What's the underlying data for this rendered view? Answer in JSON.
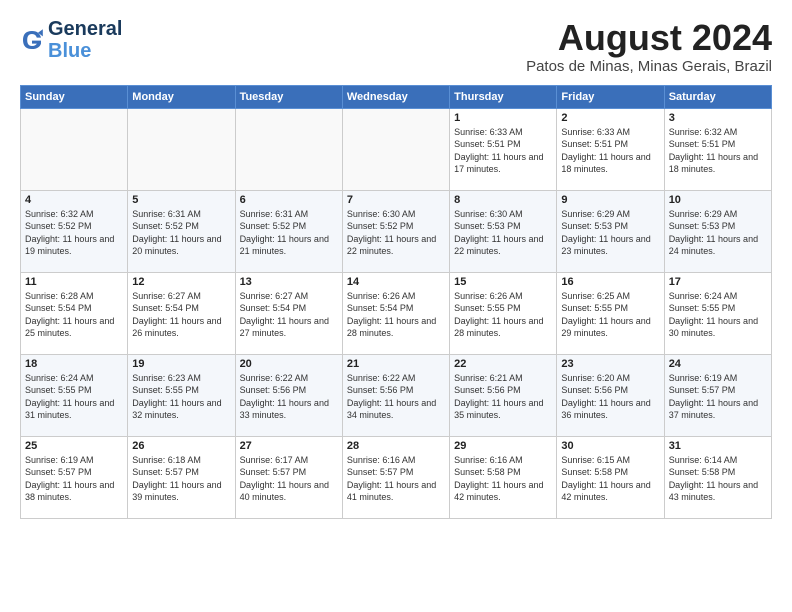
{
  "logo": {
    "line1": "General",
    "line2": "Blue"
  },
  "title": "August 2024",
  "subtitle": "Patos de Minas, Minas Gerais, Brazil",
  "weekdays": [
    "Sunday",
    "Monday",
    "Tuesday",
    "Wednesday",
    "Thursday",
    "Friday",
    "Saturday"
  ],
  "weeks": [
    [
      {
        "day": "",
        "info": ""
      },
      {
        "day": "",
        "info": ""
      },
      {
        "day": "",
        "info": ""
      },
      {
        "day": "",
        "info": ""
      },
      {
        "day": "1",
        "info": "Sunrise: 6:33 AM\nSunset: 5:51 PM\nDaylight: 11 hours and 17 minutes."
      },
      {
        "day": "2",
        "info": "Sunrise: 6:33 AM\nSunset: 5:51 PM\nDaylight: 11 hours and 18 minutes."
      },
      {
        "day": "3",
        "info": "Sunrise: 6:32 AM\nSunset: 5:51 PM\nDaylight: 11 hours and 18 minutes."
      }
    ],
    [
      {
        "day": "4",
        "info": "Sunrise: 6:32 AM\nSunset: 5:52 PM\nDaylight: 11 hours and 19 minutes."
      },
      {
        "day": "5",
        "info": "Sunrise: 6:31 AM\nSunset: 5:52 PM\nDaylight: 11 hours and 20 minutes."
      },
      {
        "day": "6",
        "info": "Sunrise: 6:31 AM\nSunset: 5:52 PM\nDaylight: 11 hours and 21 minutes."
      },
      {
        "day": "7",
        "info": "Sunrise: 6:30 AM\nSunset: 5:52 PM\nDaylight: 11 hours and 22 minutes."
      },
      {
        "day": "8",
        "info": "Sunrise: 6:30 AM\nSunset: 5:53 PM\nDaylight: 11 hours and 22 minutes."
      },
      {
        "day": "9",
        "info": "Sunrise: 6:29 AM\nSunset: 5:53 PM\nDaylight: 11 hours and 23 minutes."
      },
      {
        "day": "10",
        "info": "Sunrise: 6:29 AM\nSunset: 5:53 PM\nDaylight: 11 hours and 24 minutes."
      }
    ],
    [
      {
        "day": "11",
        "info": "Sunrise: 6:28 AM\nSunset: 5:54 PM\nDaylight: 11 hours and 25 minutes."
      },
      {
        "day": "12",
        "info": "Sunrise: 6:27 AM\nSunset: 5:54 PM\nDaylight: 11 hours and 26 minutes."
      },
      {
        "day": "13",
        "info": "Sunrise: 6:27 AM\nSunset: 5:54 PM\nDaylight: 11 hours and 27 minutes."
      },
      {
        "day": "14",
        "info": "Sunrise: 6:26 AM\nSunset: 5:54 PM\nDaylight: 11 hours and 28 minutes."
      },
      {
        "day": "15",
        "info": "Sunrise: 6:26 AM\nSunset: 5:55 PM\nDaylight: 11 hours and 28 minutes."
      },
      {
        "day": "16",
        "info": "Sunrise: 6:25 AM\nSunset: 5:55 PM\nDaylight: 11 hours and 29 minutes."
      },
      {
        "day": "17",
        "info": "Sunrise: 6:24 AM\nSunset: 5:55 PM\nDaylight: 11 hours and 30 minutes."
      }
    ],
    [
      {
        "day": "18",
        "info": "Sunrise: 6:24 AM\nSunset: 5:55 PM\nDaylight: 11 hours and 31 minutes."
      },
      {
        "day": "19",
        "info": "Sunrise: 6:23 AM\nSunset: 5:55 PM\nDaylight: 11 hours and 32 minutes."
      },
      {
        "day": "20",
        "info": "Sunrise: 6:22 AM\nSunset: 5:56 PM\nDaylight: 11 hours and 33 minutes."
      },
      {
        "day": "21",
        "info": "Sunrise: 6:22 AM\nSunset: 5:56 PM\nDaylight: 11 hours and 34 minutes."
      },
      {
        "day": "22",
        "info": "Sunrise: 6:21 AM\nSunset: 5:56 PM\nDaylight: 11 hours and 35 minutes."
      },
      {
        "day": "23",
        "info": "Sunrise: 6:20 AM\nSunset: 5:56 PM\nDaylight: 11 hours and 36 minutes."
      },
      {
        "day": "24",
        "info": "Sunrise: 6:19 AM\nSunset: 5:57 PM\nDaylight: 11 hours and 37 minutes."
      }
    ],
    [
      {
        "day": "25",
        "info": "Sunrise: 6:19 AM\nSunset: 5:57 PM\nDaylight: 11 hours and 38 minutes."
      },
      {
        "day": "26",
        "info": "Sunrise: 6:18 AM\nSunset: 5:57 PM\nDaylight: 11 hours and 39 minutes."
      },
      {
        "day": "27",
        "info": "Sunrise: 6:17 AM\nSunset: 5:57 PM\nDaylight: 11 hours and 40 minutes."
      },
      {
        "day": "28",
        "info": "Sunrise: 6:16 AM\nSunset: 5:57 PM\nDaylight: 11 hours and 41 minutes."
      },
      {
        "day": "29",
        "info": "Sunrise: 6:16 AM\nSunset: 5:58 PM\nDaylight: 11 hours and 42 minutes."
      },
      {
        "day": "30",
        "info": "Sunrise: 6:15 AM\nSunset: 5:58 PM\nDaylight: 11 hours and 42 minutes."
      },
      {
        "day": "31",
        "info": "Sunrise: 6:14 AM\nSunset: 5:58 PM\nDaylight: 11 hours and 43 minutes."
      }
    ]
  ]
}
